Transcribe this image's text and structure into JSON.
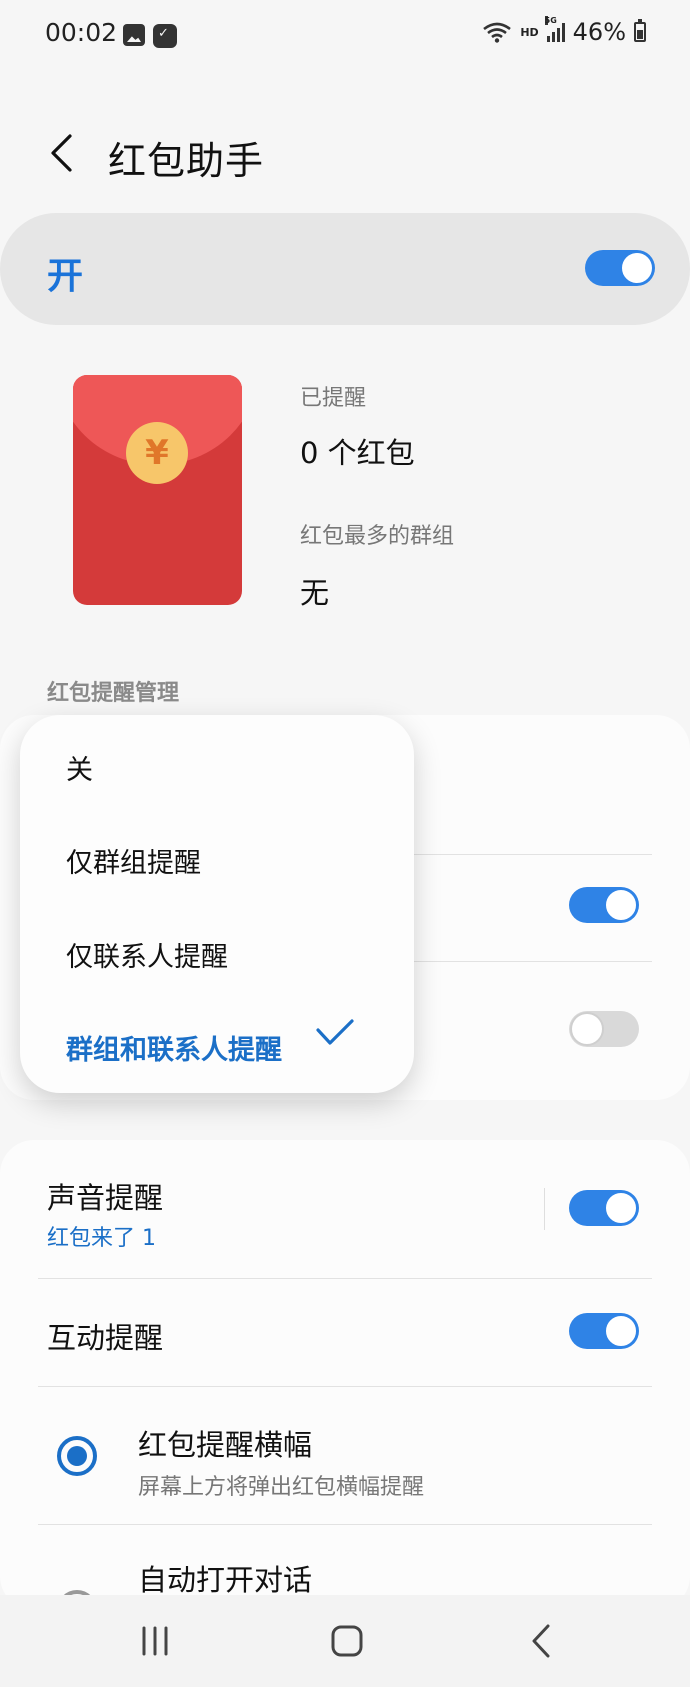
{
  "status_bar": {
    "time": "00:02",
    "left_icons": [
      "image-icon",
      "app-notification-icon"
    ],
    "hd": "HD",
    "network": "5G",
    "battery": "46%"
  },
  "header": {
    "back_icon": "chevron-left-icon",
    "title": "红包助手"
  },
  "master": {
    "label": "开",
    "enabled": true
  },
  "stats": {
    "reminded_label": "已提醒",
    "reminded_value": "0 个红包",
    "top_group_label": "红包最多的群组",
    "top_group_value": "无",
    "coin_symbol": "¥"
  },
  "section": {
    "title": "红包提醒管理"
  },
  "reminder_card": {
    "row2_toggle": true,
    "row3_toggle": false
  },
  "popup": {
    "options": [
      "关",
      "仅群组提醒",
      "仅联系人提醒",
      "群组和联系人提醒"
    ],
    "selected_index": 3
  },
  "sound": {
    "title": "声音提醒",
    "subtitle": "红包来了 1",
    "enabled": true
  },
  "interactive": {
    "title": "互动提醒",
    "enabled": true
  },
  "banner": {
    "title": "红包提醒横幅",
    "subtitle": "屏幕上方将弹出红包横幅提醒",
    "selected": true
  },
  "auto_open": {
    "title": "自动打开对话",
    "selected": false
  },
  "nav": [
    "recents-icon",
    "home-icon",
    "back-icon"
  ],
  "colors": {
    "accent": "#2f83e6",
    "selected_text": "#1b6fc7",
    "red_packet": "#d43a3a",
    "coin": "#f7c66a"
  }
}
